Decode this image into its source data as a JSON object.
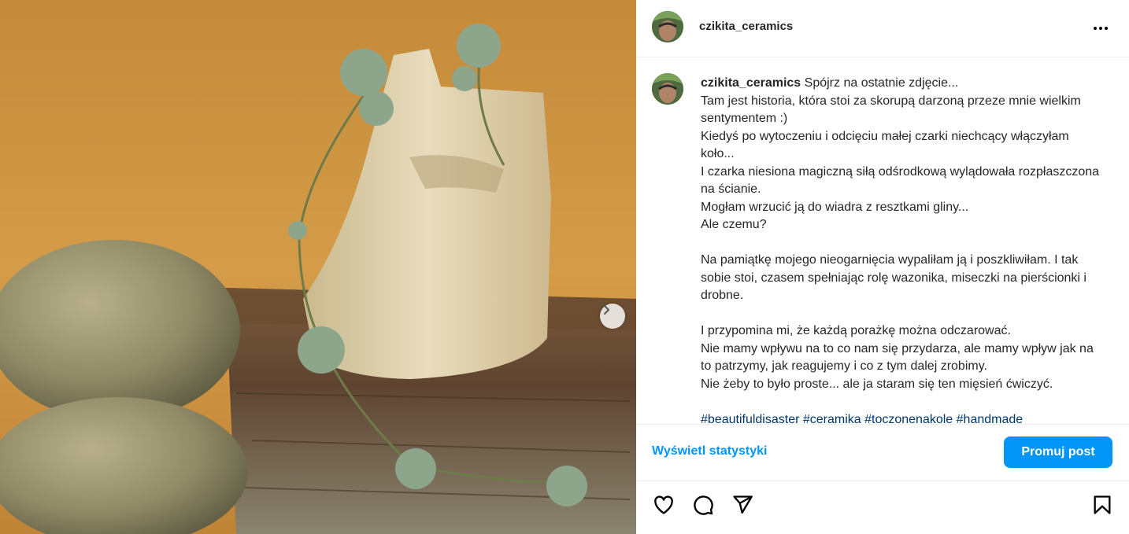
{
  "post": {
    "username": "czikita_ceramics",
    "caption": {
      "username": "czikita_ceramics",
      "lines": [
        "Spójrz na ostatnie zdjęcie...",
        "Tam jest historia, która stoi za skorupą darzoną przeze mnie wielkim sentymentem :)",
        "Kiedyś po wytoczeniu i odcięciu małej czarki niechcący włączyłam koło...",
        "I czarka niesiona magiczną siłą odśrodkową wylądowała rozpłaszczona na ścianie.",
        "Mogłam wrzucić ją do wiadra z resztkami gliny...",
        "Ale czemu?",
        "",
        "Na pamiątkę mojego nieogarnięcia wypaliłam ją i poszkliwiłam. I tak sobie stoi, czasem spełniając rolę wazonika, miseczki na pierścionki i drobne.",
        "",
        "I przypomina mi, że każdą porażkę można odczarować.",
        "Nie mamy wpływu na to co nam się przydarza, ale mamy wpływ jak na to patrzymy, jak reagujemy i co z tym dalej zrobimy.",
        "Nie żeby to było proste... ale ja staram się ten mięsień ćwiczyć.",
        ""
      ],
      "hashtags": "#beautifuldisaster #ceramika #toczonenakole #handmade"
    }
  },
  "stats": {
    "view_stats_label": "Wyświetl statystyki",
    "promote_label": "Promuj post"
  },
  "icons": {
    "more": "more-options-icon",
    "like": "heart-icon",
    "comment": "comment-icon",
    "share": "paper-plane-icon",
    "save": "bookmark-icon",
    "next": "chevron-right-icon"
  },
  "colors": {
    "accent": "#0095f6",
    "hashtag": "#00376b",
    "text": "#262626"
  }
}
